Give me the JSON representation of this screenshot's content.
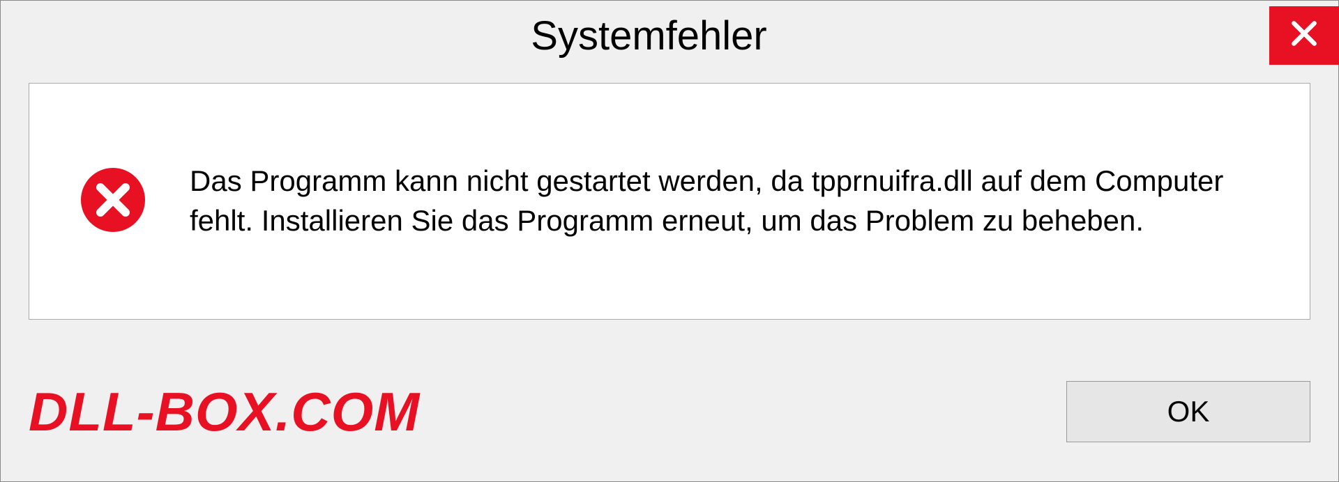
{
  "dialog": {
    "title": "Systemfehler",
    "message": "Das Programm kann nicht gestartet werden, da tpprnuifra.dll auf dem Computer fehlt. Installieren Sie das Programm erneut, um das Problem zu beheben.",
    "ok_label": "OK"
  },
  "watermark": {
    "text": "DLL-BOX.COM"
  }
}
